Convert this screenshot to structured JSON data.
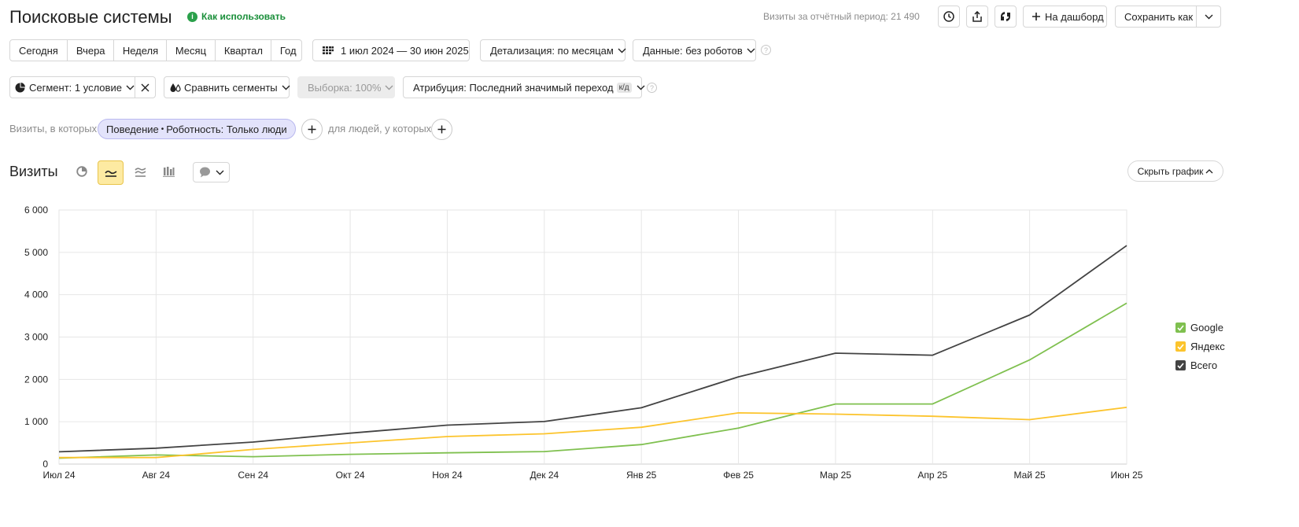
{
  "header": {
    "title": "Поисковые системы",
    "how_to_use": "Как использовать",
    "visits_label": "Визиты за отчётный период:",
    "visits_value": "21 490",
    "dashboard_label": "На дашборд",
    "save_label": "Сохранить как"
  },
  "periods": [
    "Сегодня",
    "Вчера",
    "Неделя",
    "Месяц",
    "Квартал",
    "Год"
  ],
  "filters": {
    "date_range": "1 июл 2024 — 30 июн 2025",
    "detail": "Детализация: по месяцам",
    "data": "Данные: без роботов",
    "help_glyph": "?"
  },
  "segments": {
    "segment": "Сегмент: 1 условие",
    "compare": "Сравнить сегменты",
    "sample": "Выборка: 100%",
    "attribution": "Атрибуция: Последний значимый переход",
    "attribution_badge": "к/д"
  },
  "conditions": {
    "visits_where": "Визиты, в которых",
    "tag_group": "Поведение",
    "tag_sep": "•",
    "tag_value": "Роботность: Только люди",
    "people_where": "для людей, у которых"
  },
  "chart_header": {
    "metric": "Визиты",
    "hide_chart": "Скрыть график"
  },
  "colors": {
    "google": "#7fc04f",
    "yandex": "#fcc42d",
    "total": "#434343",
    "tag_bg": "#e3e3fb",
    "tag_border": "#b9b8ef",
    "active_btn": "#fdeaa2",
    "active_btn_border": "#e8c44b",
    "green_icon": "#2aa04a"
  },
  "chart_data": {
    "type": "line",
    "x": [
      "Июл 24",
      "Авг 24",
      "Сен 24",
      "Окт 24",
      "Ноя 24",
      "Дек 24",
      "Янв 25",
      "Фев 25",
      "Мар 25",
      "Апр 25",
      "Май 25",
      "Июн 25"
    ],
    "ylim": [
      0,
      6000
    ],
    "yticks": [
      0,
      1000,
      2000,
      3000,
      4000,
      5000,
      6000
    ],
    "ytick_labels": [
      "0",
      "1 000",
      "2 000",
      "3 000",
      "4 000",
      "5 000",
      "6 000"
    ],
    "grid": true,
    "legend": "right",
    "series": [
      {
        "name": "Google",
        "color": "#7fc04f",
        "values": [
          140,
          215,
          175,
          230,
          265,
          295,
          460,
          850,
          1420,
          1420,
          2460,
          3800
        ]
      },
      {
        "name": "Яндекс",
        "color": "#fcc42d",
        "values": [
          155,
          155,
          345,
          500,
          650,
          715,
          870,
          1210,
          1180,
          1130,
          1050,
          1340
        ]
      },
      {
        "name": "Всего",
        "color": "#434343",
        "values": [
          290,
          375,
          520,
          730,
          920,
          1005,
          1330,
          2060,
          2620,
          2570,
          3520,
          5160
        ]
      }
    ]
  }
}
